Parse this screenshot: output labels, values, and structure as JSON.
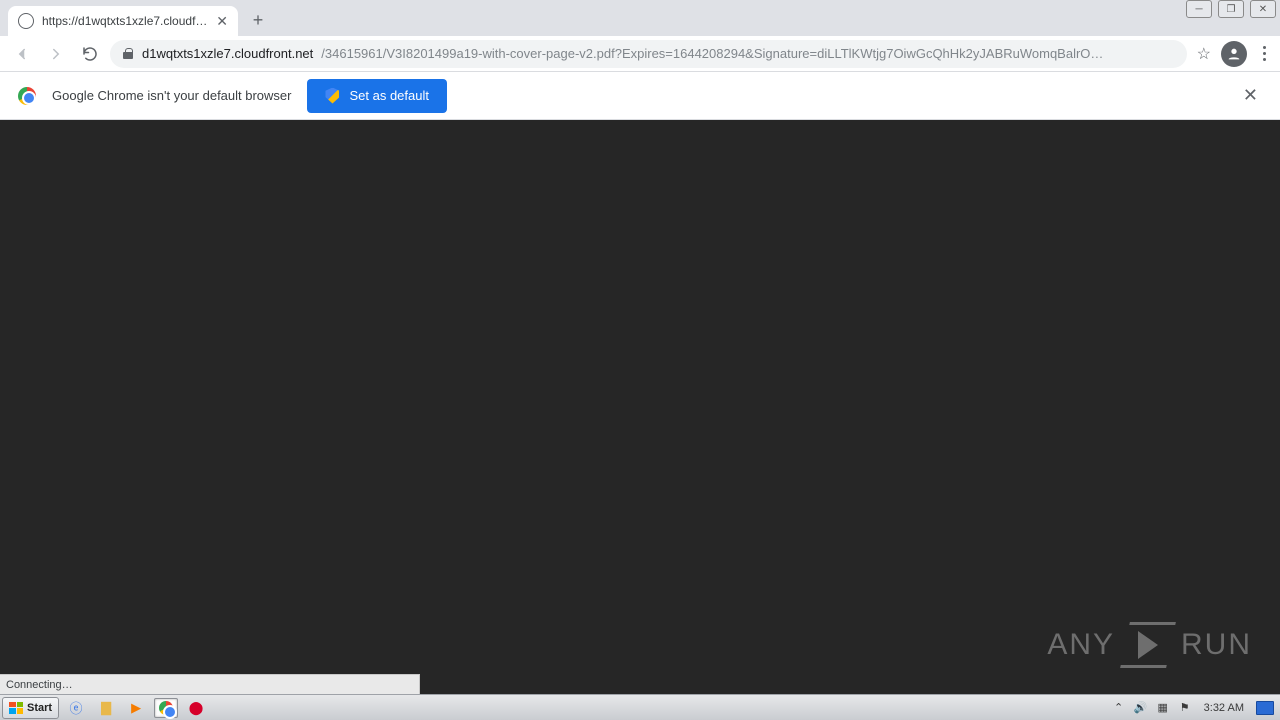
{
  "window_controls": {
    "min": "__",
    "max": "❐",
    "close": "✕"
  },
  "tab": {
    "title": "https://d1wqtxts1xzle7.cloudfront.…"
  },
  "url": {
    "host": "d1wqtxts1xzle7.cloudfront.net",
    "path": "/34615961/V3I8201499a19-with-cover-page-v2.pdf?Expires=1644208294&Signature=diLLTlKWtjg7OiwGcQhHk2yJABRuWomqBalrO…"
  },
  "infobar": {
    "message": "Google Chrome isn't your default browser",
    "button": "Set as default"
  },
  "status": "Connecting…",
  "watermark": {
    "left": "ANY",
    "right": "RUN"
  },
  "taskbar": {
    "start": "Start",
    "clock": "3:32 AM"
  }
}
